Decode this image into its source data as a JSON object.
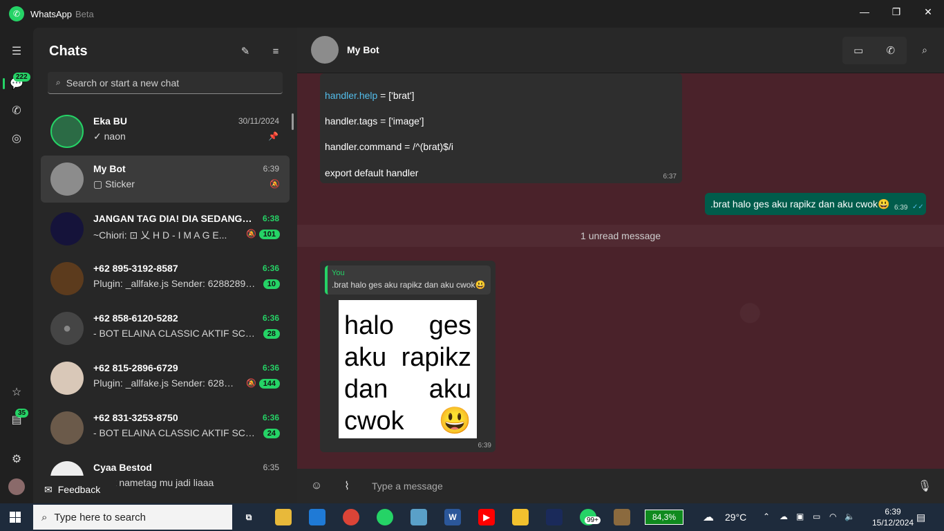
{
  "app": {
    "title": "WhatsApp",
    "beta": "Beta"
  },
  "rail": {
    "chats_badge": "222",
    "status_badge": "35"
  },
  "list": {
    "title": "Chats",
    "search_placeholder": "Search or start a new chat",
    "feedback": "Feedback",
    "chats": [
      {
        "name": "Eka BU",
        "time": "30/11/2024",
        "msg": "✓ naon",
        "badge": "",
        "pinned": true
      },
      {
        "name": "My Bot",
        "time": "6:39",
        "msg": "Sticker",
        "badge": ""
      },
      {
        "name": "JANGAN TAG DIA! DIA SEDANG A...",
        "time": "6:38",
        "msg": "~Chiori: ⊡ 乂 H D - I M A G E...",
        "badge": "101"
      },
      {
        "name": "+62 895-3192-8587",
        "time": "6:36",
        "msg": "Plugin: _allfake.js Sender: 628828966...",
        "badge": "10"
      },
      {
        "name": "+62 858-6120-5282",
        "time": "6:36",
        "msg": "- BOT ELAINA CLASSIC AKTIF  SCRIPT...",
        "badge": "28"
      },
      {
        "name": "+62 815-2896-6729",
        "time": "6:36",
        "msg": "Plugin: _allfake.js Sender: 628870...",
        "badge": "144"
      },
      {
        "name": "+62 831-3253-8750",
        "time": "6:36",
        "msg": "- BOT ELAINA CLASSIC AKTIF  SCRIPT...",
        "badge": "24"
      },
      {
        "name": "Cyaa Bestod",
        "time": "6:35",
        "msg": "h kok nametag mu jadi liaaa",
        "badge": ""
      }
    ]
  },
  "conversation": {
    "name": "My Bot",
    "code_lines": [
      {
        "pre": "handler.help",
        "post": " = ['brat']"
      },
      {
        "pre": "",
        "post": "handler.tags = ['image']"
      },
      {
        "pre": "",
        "post": "handler.command = /^(brat)$/i"
      },
      {
        "pre": "",
        "post": "export default handler"
      }
    ],
    "code_time": "6:37",
    "outgoing_text": ".brat halo ges aku rapikz dan aku cwok😃",
    "outgoing_time": "6:39",
    "unread": "1 unread message",
    "quote_author": "You",
    "quote_text": ".brat halo ges aku rapikz dan aku cwok😃",
    "sticker_rows": [
      [
        "halo",
        "ges"
      ],
      [
        "aku",
        "rapikz"
      ],
      [
        "dan",
        "aku"
      ],
      [
        "cwok",
        "😃"
      ]
    ],
    "sticker_time": "6:39",
    "composer_placeholder": "Type a message"
  },
  "taskbar": {
    "search_placeholder": "Type here to search",
    "battery": "84,3%",
    "weather": "29°C",
    "time": "6:39",
    "date": "15/12/2024",
    "wa_badge": "99+"
  },
  "colors": {
    "accent": "#25d366",
    "outgoing": "#005c4b",
    "wallpaper": "#4a222a"
  }
}
